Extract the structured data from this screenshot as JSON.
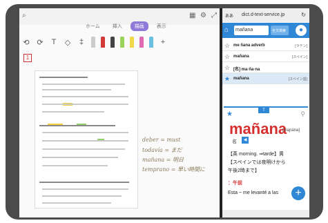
{
  "tabs": [
    "ホーム",
    "挿入",
    "描画",
    "表示"
  ],
  "active_tab_index": 2,
  "page_number": "1",
  "handwriting": [
    "deber = must",
    "todavía = まだ",
    "mañana = 明日",
    "temprano = 早い時間に"
  ],
  "browser": {
    "reader_label": "ああ",
    "url": "dict.d-text-service.jp",
    "reload_icon": "reload-icon"
  },
  "dict": {
    "search_value": "mañana",
    "search_button": "全文検索",
    "results": [
      {
        "text": "me ñana adverb",
        "tag": "[ラテン]"
      },
      {
        "text": "mañana",
        "tag": "[スペイン]"
      },
      {
        "text": "[名] ma·ña·na",
        "tag": ""
      },
      {
        "text": "mañana",
        "tag": "[スペイン語]"
      }
    ],
    "selected_result_index": 3,
    "headword": "mañana",
    "pronunciation": "[maɲána]",
    "badge": "T",
    "pos_label": "名",
    "definitions": [
      "【英 morning. ⇒tarde】男",
      "【スペインでは夜明けから",
      "午後2時まで】",
      "：午前",
      "Esta ~ me levanté a las"
    ]
  },
  "colors": {
    "accent": "#2f87d6",
    "headword": "#d5302f",
    "active_tab": "#8f7ad9"
  }
}
